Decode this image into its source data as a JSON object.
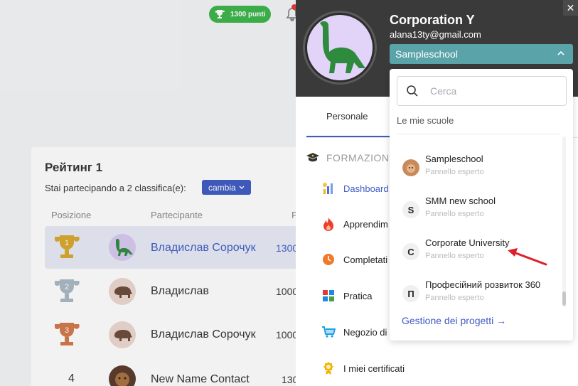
{
  "background": {
    "points_badge": "1300 punti",
    "ranking": {
      "title": "Рейтинг 1",
      "subtitle": "Stai partecipando a 2 classifica(e):",
      "change_label": "cambia",
      "columns": [
        "Posizione",
        "Partecipante",
        "P"
      ],
      "rows": [
        {
          "position": "1",
          "name": "Владислав Сорочук",
          "points": "1300"
        },
        {
          "position": "2",
          "name": "Владислав",
          "points": "1000"
        },
        {
          "position": "3",
          "name": "Владислав Сорочук",
          "points": "1000"
        },
        {
          "position": "4",
          "name": "New Name Contact",
          "points": "130"
        }
      ]
    }
  },
  "drawer": {
    "org_name": "Corporation Y",
    "email": "alana13ty@gmail.com",
    "selected_school": "Sampleschool",
    "close_label": "✕",
    "tab_personal": "Personale",
    "section_title": "FORMAZION",
    "menu": [
      {
        "label": "Dashboard",
        "icon": "chart-icon",
        "active": true
      },
      {
        "label": "Apprendim",
        "icon": "fire-icon"
      },
      {
        "label": "Completati",
        "icon": "clock-icon"
      },
      {
        "label": "Pratica",
        "icon": "tiles-icon"
      },
      {
        "label": "Negozio di",
        "icon": "cart-icon"
      },
      {
        "label": "I miei certificati",
        "icon": "badge-icon"
      }
    ]
  },
  "dropdown": {
    "search_placeholder": "Cerca",
    "my_schools_label": "Le mie scuole",
    "schools": [
      {
        "name": "Sampleschool",
        "role": "Pannello esperto",
        "logo": ""
      },
      {
        "name": "SMM new school",
        "role": "Pannello esperto",
        "logo": "S"
      },
      {
        "name": "Corporate University",
        "role": "Pannello esperto",
        "logo": "C"
      },
      {
        "name": "Професійний розвиток 360",
        "role": "Pannello esperto",
        "logo": "П"
      }
    ],
    "manage_link": "Gestione dei progetti →"
  },
  "colors": {
    "accent": "#3f5bc4",
    "teal_select": "#5aa3a8",
    "header_dark": "#3a3a3a",
    "green_badge": "#3ab54a",
    "arrow_red": "#e0202a"
  }
}
